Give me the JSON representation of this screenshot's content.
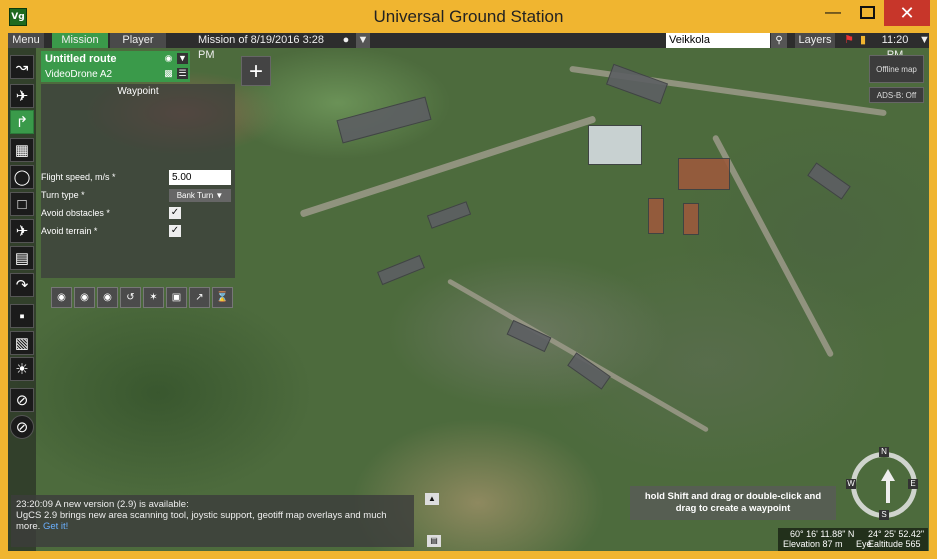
{
  "window": {
    "app_icon": "Vg",
    "title": "Universal Ground Station",
    "min_icon": "window-minimize-icon",
    "max_icon": "window-maximize-icon",
    "close_icon": "window-close-icon",
    "close_glyph": "✕",
    "min_glyph": "—"
  },
  "topbar": {
    "menu": "Menu",
    "mission": "Mission",
    "player": "Player",
    "mission_title": "Mission of 8/19/2016 3:28 PM",
    "search_value": "Veikkola",
    "layers": "Layers",
    "time": "11:20 PM",
    "accent_color": "#3a9a4a"
  },
  "route": {
    "name": "Untitled route",
    "device": "VideoDrone A2"
  },
  "waypoint": {
    "title": "Waypoint",
    "flight_speed_label": "Flight speed, m/s *",
    "flight_speed_value": "5.00",
    "turn_type_label": "Turn type *",
    "turn_type_value": "Bank Turn",
    "avoid_obstacles_label": "Avoid obstacles *",
    "avoid_obstacles_checked": true,
    "avoid_terrain_label": "Avoid terrain *",
    "avoid_terrain_checked": true
  },
  "right_buttons": {
    "offline_map": "Offline map",
    "adsb": "ADS-B: Off"
  },
  "notification": {
    "time": "23:20:09",
    "line1": "A new version (2.9) is available:",
    "line2": "UgCS 2.9 brings new area scanning tool, joystic support, geotiff map overlays and much more.",
    "link": "Get it!"
  },
  "hint": {
    "line1": "hold Shift and drag or double-click and",
    "line2": "drag to create a waypoint"
  },
  "compass": {
    "n": "N",
    "s": "S",
    "e": "E",
    "w": "W"
  },
  "coords": {
    "lat": "60° 16' 11.88\" N",
    "lon": "24° 25' 52.42\" E",
    "elevation": "Elevation 87 m",
    "eye_altitude": "Eye altitude 565 m"
  }
}
